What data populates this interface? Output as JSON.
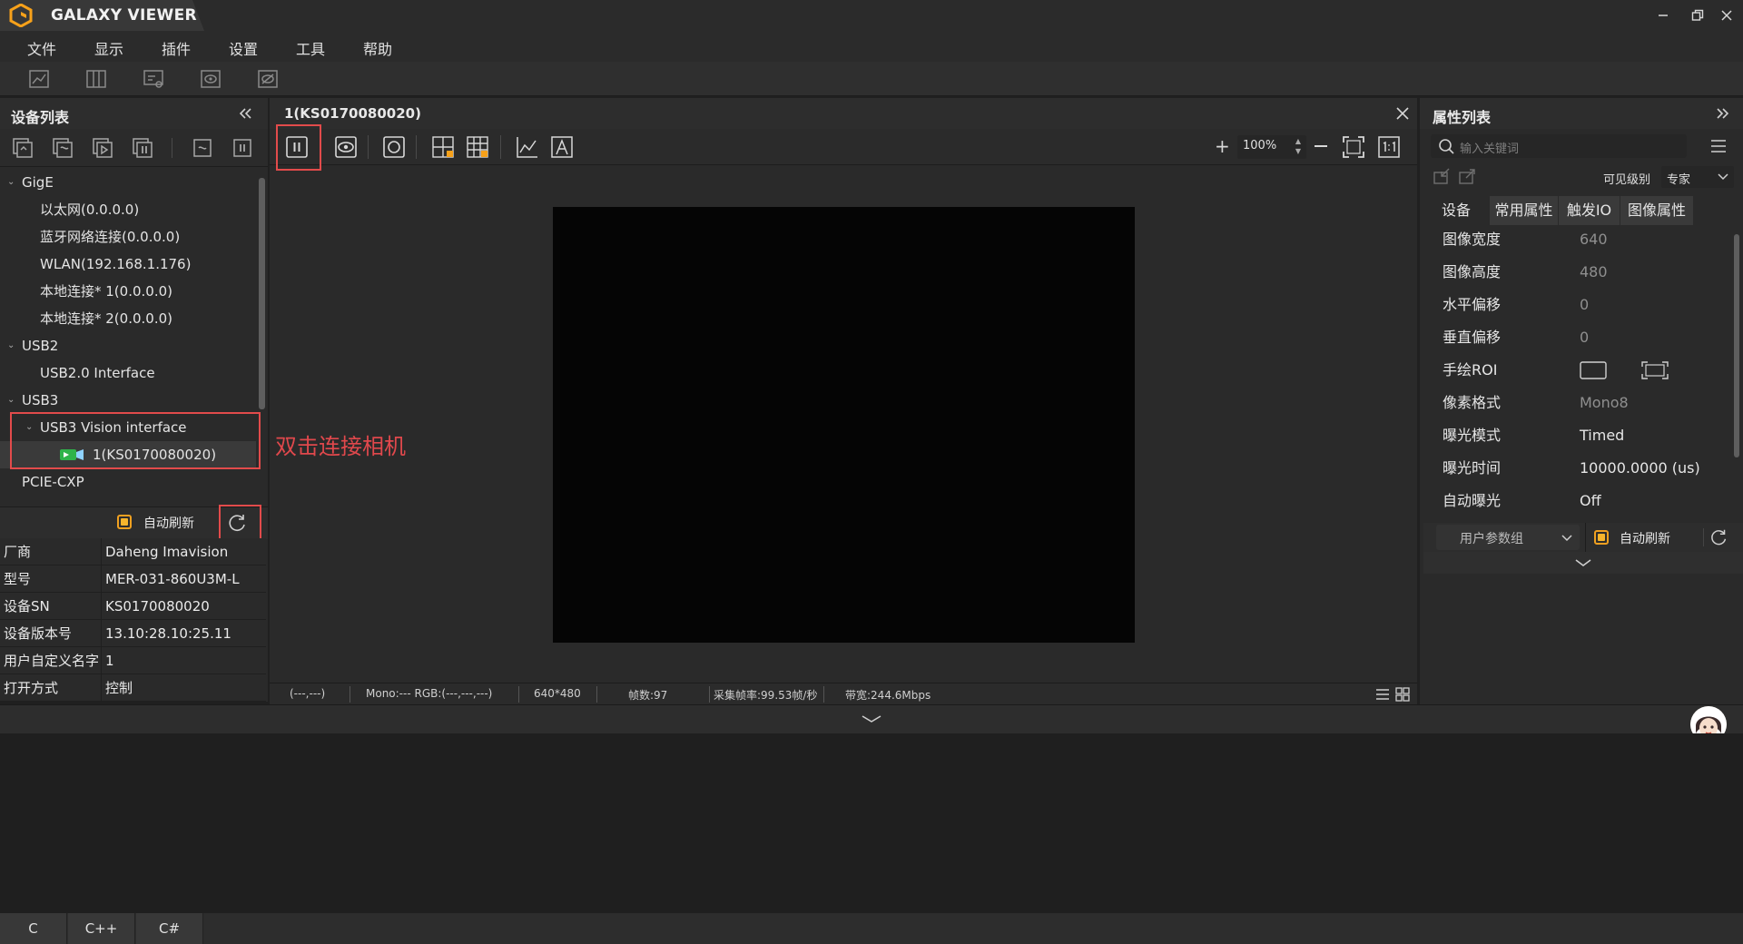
{
  "app": {
    "title": "GALAXY VIEWER"
  },
  "menu": [
    "文件",
    "显示",
    "插件",
    "设置",
    "工具",
    "帮助"
  ],
  "device_panel": {
    "title": "设备列表",
    "tree": {
      "gige": "GigE",
      "ethernet": "以太网(0.0.0.0)",
      "bluetooth": "蓝牙网络连接(0.0.0.0)",
      "wlan": "WLAN(192.168.1.176)",
      "local1": "本地连接* 1(0.0.0.0)",
      "local2": "本地连接* 2(0.0.0.0)",
      "usb2": "USB2",
      "usb2_iface": "USB2.0 Interface",
      "usb3": "USB3",
      "usb3_iface": "USB3 Vision interface",
      "camera": "1(KS0170080020)",
      "pcie": "PCIE-CXP"
    },
    "auto_refresh": "自动刷新",
    "info": [
      {
        "key": "厂商",
        "value": "Daheng Imavision"
      },
      {
        "key": "型号",
        "value": "MER-031-860U3M-L"
      },
      {
        "key": "设备SN",
        "value": "KS0170080020"
      },
      {
        "key": "设备版本号",
        "value": "13.10:28.10:25.11"
      },
      {
        "key": "用户自定义名字",
        "value": "1"
      },
      {
        "key": "打开方式",
        "value": "控制"
      }
    ]
  },
  "viewer": {
    "title": "1(KS0170080020)",
    "zoom": "100%",
    "annotation": "双击连接相机",
    "status": {
      "coord": "(---,---)",
      "pixel": "Mono:---  RGB:(---,---,---)",
      "resolution": "640*480",
      "frames": "帧数:97",
      "fps": "采集帧率:99.53帧/秒",
      "bandwidth": "带宽:244.6Mbps"
    }
  },
  "properties": {
    "title": "属性列表",
    "search_placeholder": "输入关键词",
    "visibility_label": "可见级别",
    "visibility_value": "专家",
    "tabs": [
      "设备",
      "常用属性",
      "触发IO",
      "图像属性"
    ],
    "rows": [
      {
        "key": "图像宽度",
        "value": "640"
      },
      {
        "key": "图像高度",
        "value": "480"
      },
      {
        "key": "水平偏移",
        "value": "0"
      },
      {
        "key": "垂直偏移",
        "value": "0"
      },
      {
        "key": "手绘ROI",
        "value": ""
      },
      {
        "key": "像素格式",
        "value": "Mono8"
      },
      {
        "key": "曝光模式",
        "value": "Timed"
      },
      {
        "key": "曝光时间",
        "value": "10000.0000 (us)"
      },
      {
        "key": "自动曝光",
        "value": "Off"
      }
    ],
    "user_group": "用户参数组",
    "auto_refresh": "自动刷新"
  },
  "code_tabs": [
    "C",
    "C++",
    "C#"
  ],
  "colors": {
    "accent_orange": "#f7a11a",
    "highlight_red": "#e24b4b",
    "bg": "#2a2a2a"
  }
}
